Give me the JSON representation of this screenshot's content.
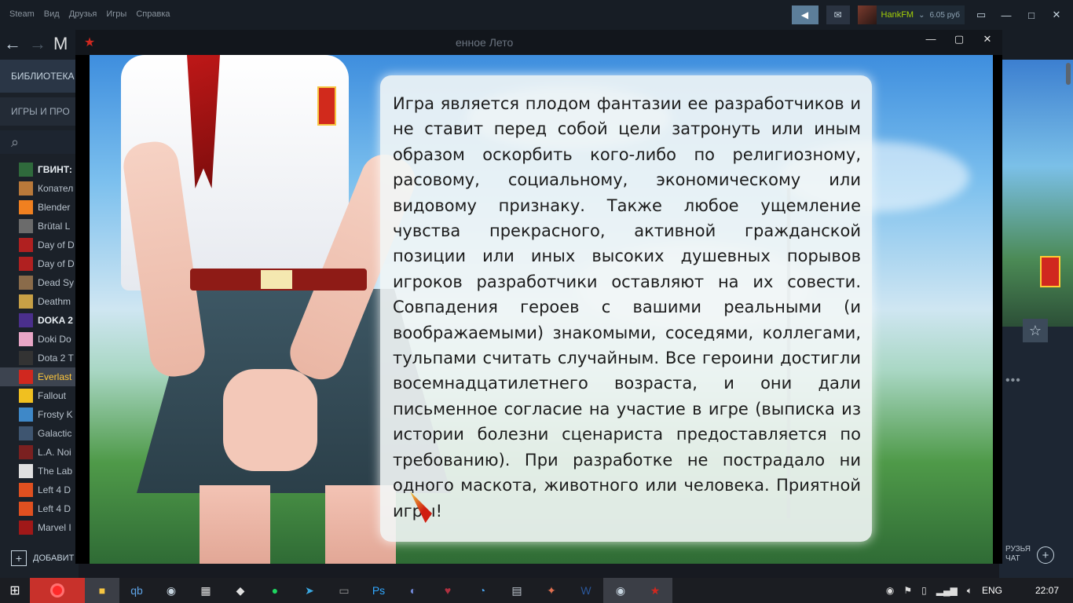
{
  "steam": {
    "menu": [
      "Steam",
      "Вид",
      "Друзья",
      "Игры",
      "Справка"
    ],
    "username": "HankFM",
    "balance": "6.05 руб",
    "nav_m": "М",
    "library_label": "БИБЛИОТЕКА",
    "games_header": "ИГРЫ И ПРО",
    "add_game_label": "ДОБАВИТ",
    "friends_label_1": "РУЗЬЯ",
    "friends_label_2": "ЧАТ",
    "games": [
      {
        "name": "ГВИНТ:",
        "bold": true,
        "color": "#2f6a3c"
      },
      {
        "name": "Копател",
        "bold": false,
        "color": "#b9793a"
      },
      {
        "name": "Blender",
        "bold": false,
        "color": "#f08020"
      },
      {
        "name": "Brütal L",
        "bold": false,
        "color": "#6b6b6b"
      },
      {
        "name": "Day of D",
        "bold": false,
        "color": "#b02020"
      },
      {
        "name": "Day of D",
        "bold": false,
        "color": "#b02020"
      },
      {
        "name": "Dead Sy",
        "bold": false,
        "color": "#8a6b4a"
      },
      {
        "name": "Deathm",
        "bold": false,
        "color": "#c7a046"
      },
      {
        "name": "DOKA 2",
        "bold": true,
        "color": "#4a2f8c"
      },
      {
        "name": "Doki Do",
        "bold": false,
        "color": "#e8a6c6"
      },
      {
        "name": "Dota 2 T",
        "bold": false,
        "color": "#333333"
      },
      {
        "name": "Everlast",
        "bold": false,
        "active": true,
        "color": "#d0281f"
      },
      {
        "name": "Fallout",
        "bold": false,
        "color": "#f0c020"
      },
      {
        "name": "Frosty K",
        "bold": false,
        "color": "#3e88c8"
      },
      {
        "name": "Galactic",
        "bold": false,
        "color": "#3e5570"
      },
      {
        "name": "L.A. Noi",
        "bold": false,
        "color": "#7a2020"
      },
      {
        "name": "The Lab",
        "bold": false,
        "color": "#e0e0e0"
      },
      {
        "name": "Left 4 D",
        "bold": false,
        "color": "#e05020"
      },
      {
        "name": "Left 4 D",
        "bold": false,
        "color": "#e05020"
      },
      {
        "name": "Marvel I",
        "bold": false,
        "color": "#a01818"
      }
    ]
  },
  "game_window": {
    "title": "енное Лето"
  },
  "disclaimer": {
    "text": "Игра является плодом фантазии ее разработчиков и не ставит перед собой цели затронуть или иным образом оскорбить кого-либо по религиозному, расовому, социальному, экономическому или видовому признаку. Также любое ущемление чувства прекрасного, активной гражданской позиции или иных высоких душевных порывов игроков разработчики оставляют на их совести. Совпадения героев с вашими реальными (и воображаемыми) знакомыми, соседями, коллегами, тульпами считать случайным. Все героини достигли восемнадцатилетнего возраста, и они дали письменное согласие на участие в игре (выписка из истории болезни сценариста предоставляется по требованию). При разработке не пострадало ни одного маскота, животного или человека. Приятной игры!"
  },
  "taskbar": {
    "apps": [
      {
        "name": "opera-icon",
        "glyph": "●",
        "color": "#ff2a2a",
        "highlight": true
      },
      {
        "name": "file-explorer-icon",
        "glyph": "■",
        "color": "#f5c542",
        "selected": true
      },
      {
        "name": "qbittorrent-icon",
        "glyph": "qb",
        "color": "#5ea3e6"
      },
      {
        "name": "steam-icon",
        "glyph": "◉",
        "color": "#c7d5e0"
      },
      {
        "name": "clapperboard-icon",
        "glyph": "▦",
        "color": "#e0e0e0"
      },
      {
        "name": "alien-icon",
        "glyph": "◆",
        "color": "#e0e0e0"
      },
      {
        "name": "spotify-icon",
        "glyph": "●",
        "color": "#1ed760"
      },
      {
        "name": "telegram-icon",
        "glyph": "➤",
        "color": "#3aa7e0"
      },
      {
        "name": "terminal-icon",
        "glyph": "▭",
        "color": "#9a9a9a"
      },
      {
        "name": "photoshop-icon",
        "glyph": "Ps",
        "color": "#31a8ff"
      },
      {
        "name": "discord-icon",
        "glyph": "◐",
        "color": "#7289da"
      },
      {
        "name": "heart-app-icon",
        "glyph": "♥",
        "color": "#b03040"
      },
      {
        "name": "browser-icon",
        "glyph": "◔",
        "color": "#4aa0e8"
      },
      {
        "name": "calculator-icon",
        "glyph": "▤",
        "color": "#c0c8d0"
      },
      {
        "name": "game-app-icon",
        "glyph": "✦",
        "color": "#e07050"
      },
      {
        "name": "word-icon",
        "glyph": "W",
        "color": "#2b579a"
      },
      {
        "name": "steam-running-icon",
        "glyph": "◉",
        "color": "#c7d5e0",
        "selected": true
      },
      {
        "name": "everlasting-summer-icon",
        "glyph": "★",
        "color": "#d0281f",
        "selected": true
      }
    ],
    "lang": "ENG",
    "time": "22:07"
  }
}
